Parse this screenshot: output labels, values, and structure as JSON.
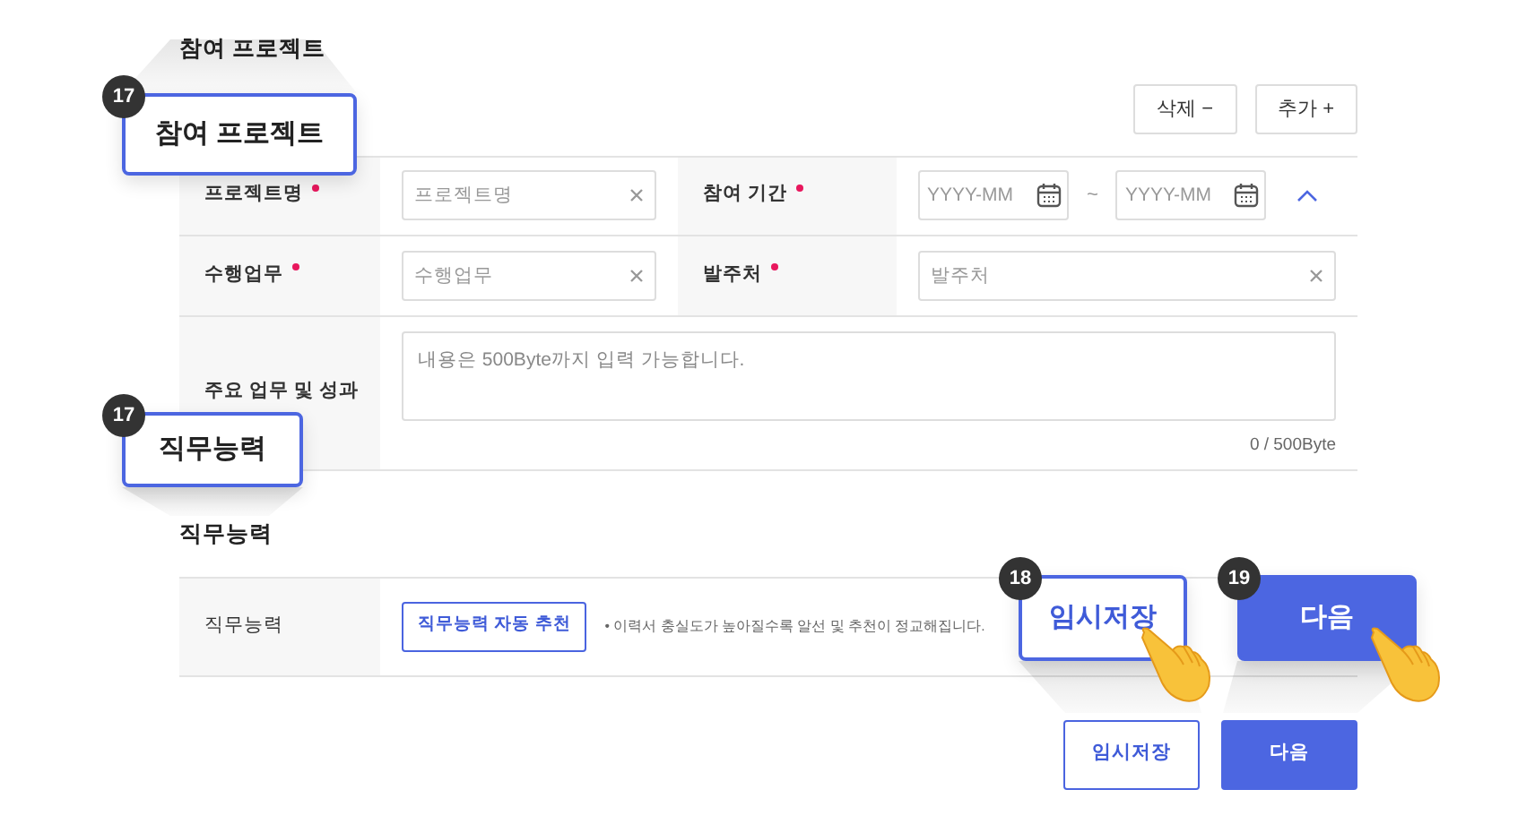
{
  "project_section": {
    "title": "참여 프로젝트",
    "buttons": [
      {
        "label": "삭제",
        "symbol": "−"
      },
      {
        "label": "추가",
        "symbol": "+"
      }
    ],
    "expanded": true,
    "rows": [
      {
        "fields": [
          {
            "label": "프로젝트명",
            "required": true,
            "kind": "text",
            "placeholder": "프로젝트명"
          },
          {
            "label": "참여 기간",
            "required": true,
            "kind": "period",
            "placeholders": [
              "YYYY-MM",
              "YYYY-MM"
            ],
            "separator": "~"
          }
        ]
      },
      {
        "fields": [
          {
            "label": "수행업무",
            "required": true,
            "kind": "text",
            "placeholder": "수행업무"
          },
          {
            "label": "발주처",
            "required": true,
            "kind": "text",
            "placeholder": "발주처"
          }
        ]
      },
      {
        "fields": [
          {
            "label": "주요 업무 및 성과",
            "required": false,
            "kind": "textarea",
            "placeholder": "내용은 500Byte까지 입력 가능합니다.",
            "counter": "0 / 500Byte"
          }
        ]
      }
    ]
  },
  "competency_section": {
    "title": "직무능력",
    "label": "직무능력",
    "button": "직무능력 자동 추천",
    "hint": "• 이력서 충실도가 높아질수록 알선 및 추천이 정교해집니다."
  },
  "footer_buttons": [
    {
      "label": "임시저장",
      "kind": "outline"
    },
    {
      "label": "다음",
      "kind": "primary"
    }
  ],
  "callouts": [
    {
      "number": "17",
      "label": "참여 프로젝트",
      "kind": "outline",
      "pointer": false
    },
    {
      "number": "17",
      "label": "직무능력",
      "kind": "outline",
      "pointer": false
    },
    {
      "number": "18",
      "label": "임시저장",
      "kind": "outline",
      "pointer": true
    },
    {
      "number": "19",
      "label": "다음",
      "kind": "primary",
      "pointer": true
    }
  ]
}
